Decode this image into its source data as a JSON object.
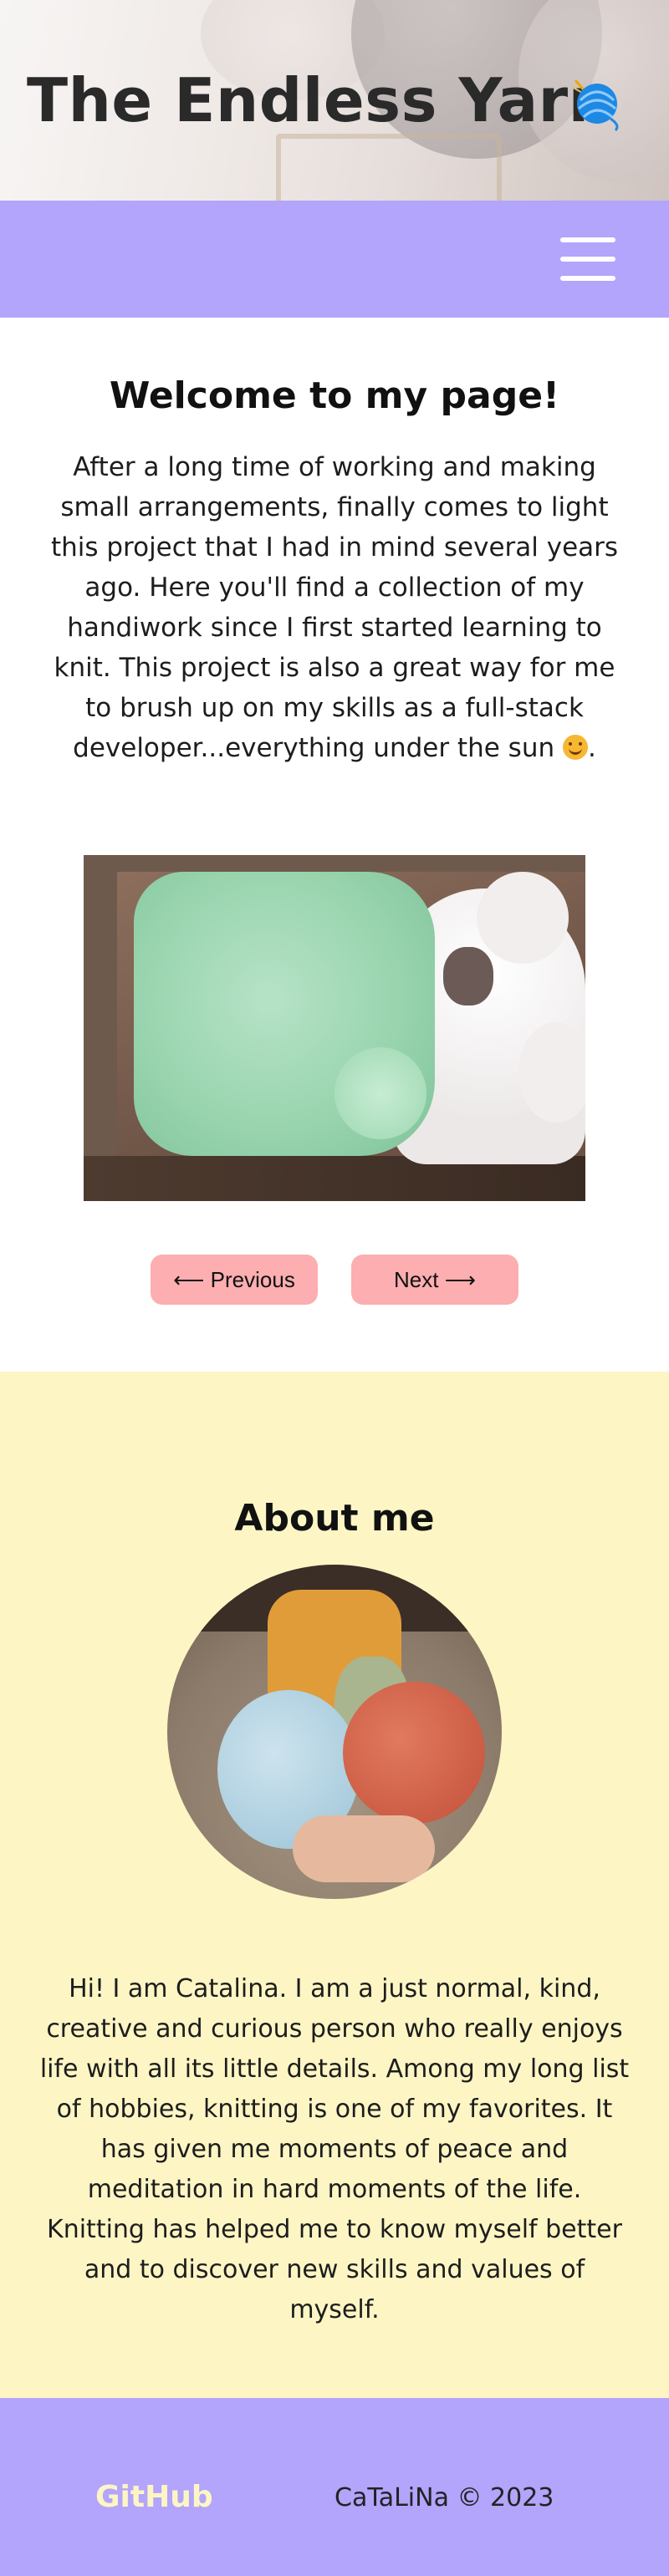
{
  "header": {
    "title": "The Endless Yarn",
    "logo_icon": "yarn-ball-icon",
    "background_colors": [
      "#f7f5f4",
      "#cfc4c0"
    ]
  },
  "nav": {
    "menu_icon": "hamburger-menu-icon",
    "background": "#b3a4fc"
  },
  "welcome": {
    "heading": "Welcome to my page!",
    "text": "After a long time of working and making small arrangements, finally comes to light this project that I had in mind several years ago. Here you'll find a collection of my handiwork since I first started learning to knit. This project is also a great way for me to brush up on my skills as a full-stack developer...everything under the sun",
    "emoji_icon": "smiling-face-icon",
    "text_end": "."
  },
  "gallery": {
    "prev_label": "⟵ Previous",
    "next_label": "Next ⟶",
    "button_color": "#fcaeb0"
  },
  "about": {
    "heading": "About me",
    "text": "Hi! I am Catalina. I am a just normal, kind, creative and curious person who really enjoys life with all its little details. Among my long list of hobbies, knitting is one of my favorites. It has given me moments of peace and meditation in hard moments of the life. Knitting has helped me to know myself better and to discover new skills and values of myself.",
    "background": "#fdf6c4"
  },
  "footer": {
    "github_label": "GitHub",
    "copyright": "CaTaLiNa © 2023",
    "background": "#b3a4fc"
  }
}
